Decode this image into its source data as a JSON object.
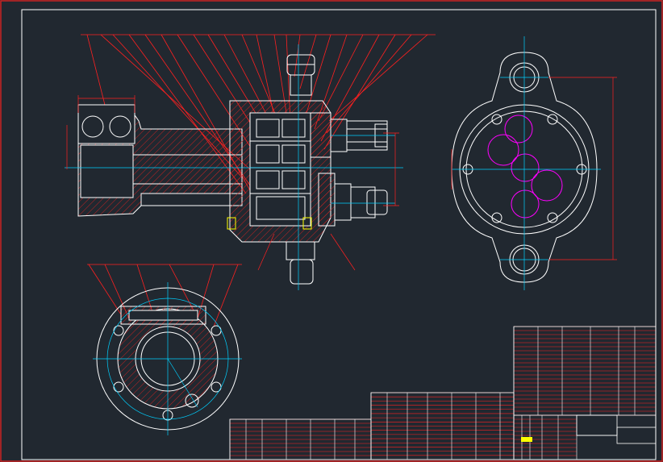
{
  "drawing": {
    "background": "#212830",
    "colors": {
      "border": "#ffffff",
      "outer_frame": "#cc2222",
      "outline": "#ffffff",
      "leader": "#ff2020",
      "hatch": "#cc2222",
      "center_line": "#00d0ff",
      "gear": "#ff00ff",
      "dimension": "#ff2020",
      "title_line": "#ff2020",
      "title_line_secondary": "#ffffff",
      "highlight": "#ffff00"
    }
  },
  "views": [
    {
      "name": "front-section-view",
      "kind": "sectional assembly"
    },
    {
      "name": "side-view",
      "kind": "end view with gear circles"
    },
    {
      "name": "bottom-section-view",
      "kind": "flange section"
    }
  ],
  "title_block": {
    "stamp_label": "",
    "highlight_color": "#ffff00"
  }
}
